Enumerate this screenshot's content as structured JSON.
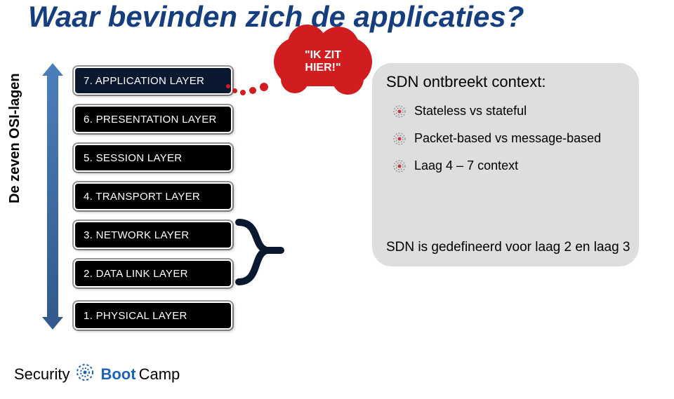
{
  "title": "Waar bevinden zich de applicaties?",
  "vlabel": "De zeven OSI-lagen",
  "layers": {
    "l7": "7. APPLICATION LAYER",
    "l6": "6. PRESENTATION LAYER",
    "l5": "5. SESSION LAYER",
    "l4": "4. TRANSPORT LAYER",
    "l3": "3. NETWORK LAYER",
    "l2": "2. DATA LINK LAYER",
    "l1": "1. PHYSICAL LAYER"
  },
  "bubble": {
    "line1": "\"IK ZIT",
    "line2": "HIER!\""
  },
  "panel": {
    "title": "SDN ontbreekt context:",
    "bullets": [
      "Stateless vs stateful",
      "Packet-based vs message-based",
      "Laag 4 – 7 context"
    ],
    "footer": "SDN is gedefineerd voor  laag 2 en laag 3"
  },
  "logo": {
    "part1": "Security",
    "part2": "Boot",
    "part3": "Camp"
  }
}
